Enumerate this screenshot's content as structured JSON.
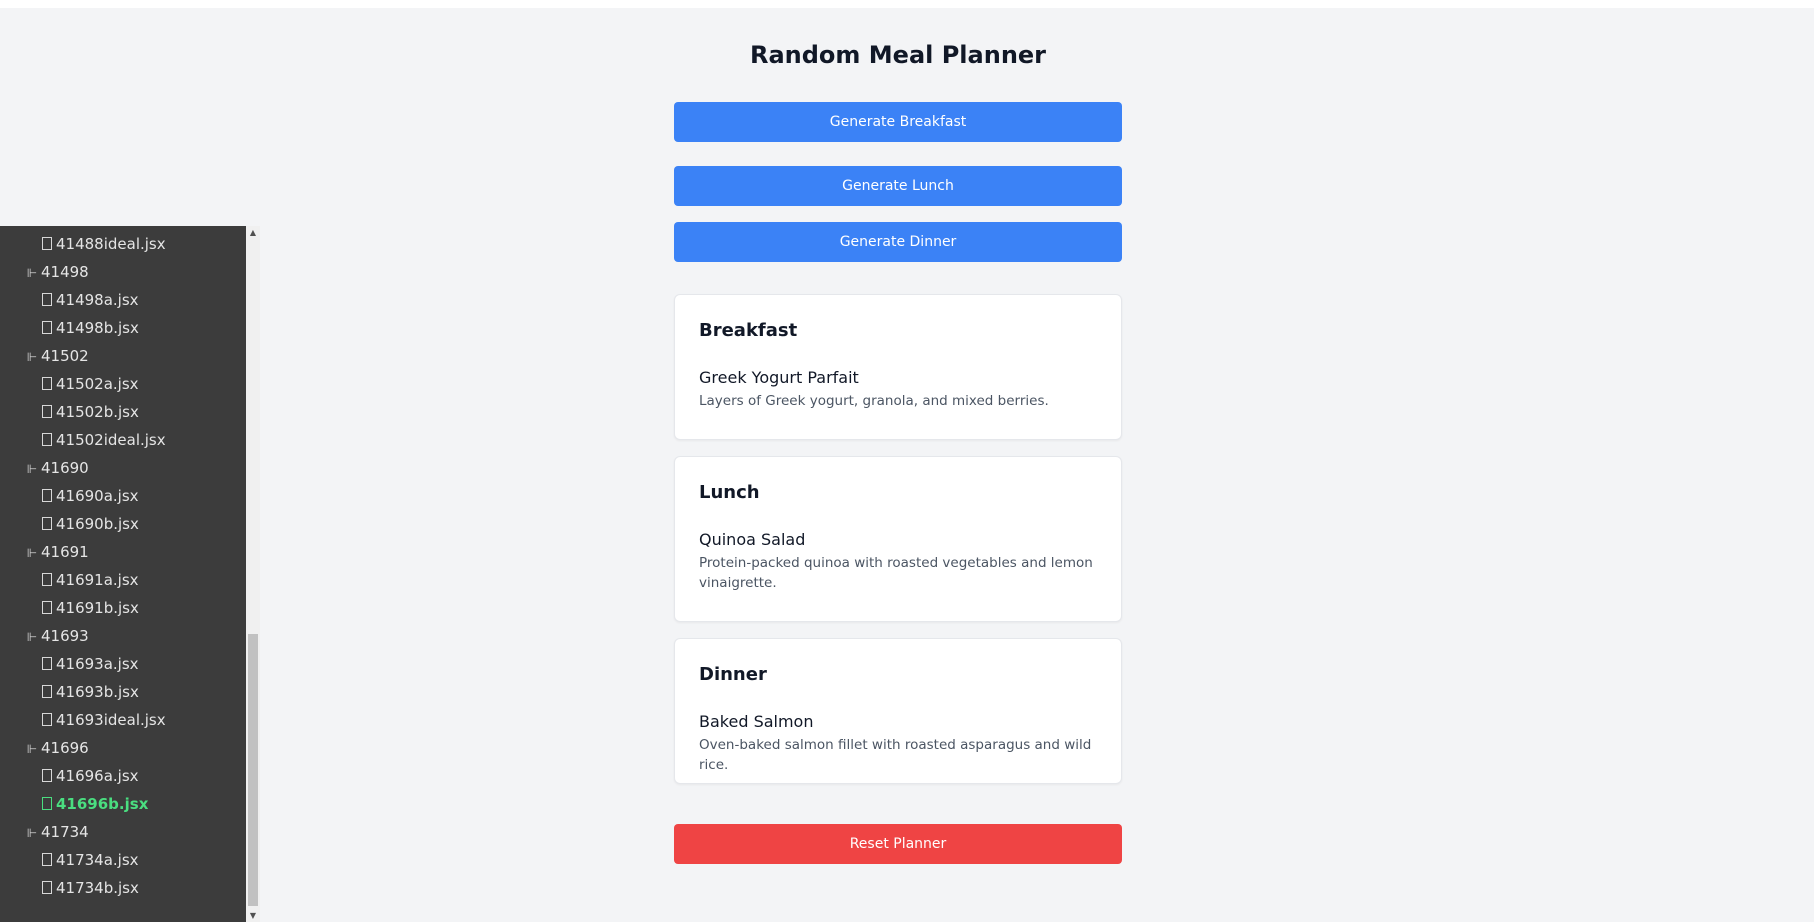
{
  "app": {
    "title": "Random Meal Planner",
    "buttons": {
      "breakfast": "Generate Breakfast",
      "lunch": "Generate Lunch",
      "dinner": "Generate Dinner",
      "reset": "Reset Planner"
    },
    "meals": {
      "breakfast": {
        "heading": "Breakfast",
        "name": "Greek Yogurt Parfait",
        "description": "Layers of Greek yogurt, granola, and mixed berries."
      },
      "lunch": {
        "heading": "Lunch",
        "name": "Quinoa Salad",
        "description": "Protein-packed quinoa with roasted vegetables and lemon vinaigrette."
      },
      "dinner": {
        "heading": "Dinner",
        "name": "Baked Salmon",
        "description": "Oven-baked salmon fillet with roasted asparagus and wild rice."
      }
    },
    "colors": {
      "primary_button": "#3b82f6",
      "danger_button": "#ef4444",
      "background": "#f3f4f6"
    }
  },
  "file_tree": {
    "items": [
      {
        "type": "file",
        "label": "41488ideal.jsx"
      },
      {
        "type": "folder",
        "label": "41498"
      },
      {
        "type": "file",
        "label": "41498a.jsx"
      },
      {
        "type": "file",
        "label": "41498b.jsx"
      },
      {
        "type": "folder",
        "label": "41502"
      },
      {
        "type": "file",
        "label": "41502a.jsx"
      },
      {
        "type": "file",
        "label": "41502b.jsx"
      },
      {
        "type": "file",
        "label": "41502ideal.jsx"
      },
      {
        "type": "folder",
        "label": "41690"
      },
      {
        "type": "file",
        "label": "41690a.jsx"
      },
      {
        "type": "file",
        "label": "41690b.jsx"
      },
      {
        "type": "folder",
        "label": "41691"
      },
      {
        "type": "file",
        "label": "41691a.jsx"
      },
      {
        "type": "file",
        "label": "41691b.jsx"
      },
      {
        "type": "folder",
        "label": "41693"
      },
      {
        "type": "file",
        "label": "41693a.jsx"
      },
      {
        "type": "file",
        "label": "41693b.jsx"
      },
      {
        "type": "file",
        "label": "41693ideal.jsx"
      },
      {
        "type": "folder",
        "label": "41696"
      },
      {
        "type": "file",
        "label": "41696a.jsx"
      },
      {
        "type": "file",
        "label": "41696b.jsx",
        "active": true
      },
      {
        "type": "folder",
        "label": "41734"
      },
      {
        "type": "file",
        "label": "41734a.jsx"
      },
      {
        "type": "file",
        "label": "41734b.jsx"
      }
    ],
    "active_color": "#4ade80",
    "folder_icon": "tree-icon",
    "file_icon": "file-icon"
  }
}
